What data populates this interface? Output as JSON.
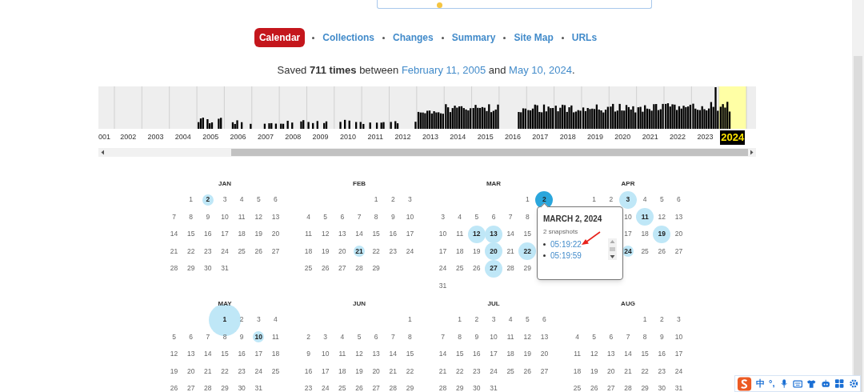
{
  "nav": [
    {
      "label": "Calendar",
      "selected": true
    },
    {
      "label": "Collections",
      "selected": false
    },
    {
      "label": "Changes",
      "selected": false
    },
    {
      "label": "Summary",
      "selected": false
    },
    {
      "label": "Site Map",
      "selected": false
    },
    {
      "label": "URLs",
      "selected": false
    }
  ],
  "summary": {
    "lead": "Saved **711 times** between",
    "start": "February 11, 2005",
    "middle": "and",
    "end": "May 10, 2024",
    "tail": "."
  },
  "years": [
    {
      "label": "001",
      "selected": false
    },
    {
      "label": "2002",
      "selected": false
    },
    {
      "label": "2003",
      "selected": false
    },
    {
      "label": "2004",
      "selected": false
    },
    {
      "label": "2005",
      "selected": false
    },
    {
      "label": "2006",
      "selected": false
    },
    {
      "label": "2007",
      "selected": false
    },
    {
      "label": "2008",
      "selected": false
    },
    {
      "label": "2009",
      "selected": false
    },
    {
      "label": "2010",
      "selected": false
    },
    {
      "label": "2011",
      "selected": false
    },
    {
      "label": "2012",
      "selected": false
    },
    {
      "label": "2013",
      "selected": false
    },
    {
      "label": "2014",
      "selected": false
    },
    {
      "label": "2015",
      "selected": false
    },
    {
      "label": "2016",
      "selected": false
    },
    {
      "label": "2017",
      "selected": false
    },
    {
      "label": "2018",
      "selected": false
    },
    {
      "label": "2019",
      "selected": false
    },
    {
      "label": "2020",
      "selected": false
    },
    {
      "label": "2021",
      "selected": false
    },
    {
      "label": "2022",
      "selected": false
    },
    {
      "label": "2023",
      "selected": false
    },
    {
      "label": "2024",
      "selected": true
    }
  ],
  "calendar": {
    "months": [
      {
        "name": "JAN",
        "weeks": [
          {
            "kind": "padded",
            "days": [
              "1",
              {
                "label": "2",
                "kind": "small",
                "selected": false
              },
              "3",
              "4",
              "5",
              "6"
            ]
          },
          {
            "days": [
              "7",
              "8",
              "9",
              "10",
              "11",
              "12",
              "13"
            ]
          },
          {
            "days": [
              "14",
              "15",
              "16",
              "17",
              "18",
              "19",
              "20"
            ]
          },
          {
            "days": [
              "21",
              "22",
              "23",
              "24",
              "25",
              "26",
              "27"
            ]
          },
          {
            "days": [
              "28",
              "29",
              "30",
              "31"
            ]
          }
        ]
      },
      {
        "name": "FEB",
        "weeks": [
          {
            "kind": "padded",
            "days": [
              "1",
              "2",
              "3"
            ]
          },
          {
            "days": [
              "4",
              "5",
              "6",
              "7",
              "8",
              "9",
              "10"
            ]
          },
          {
            "days": [
              "11",
              "12",
              "13",
              "14",
              "15",
              "16",
              "17"
            ]
          },
          {
            "days": [
              "18",
              "19",
              "20",
              {
                "label": "21",
                "kind": "small",
                "selected": false
              },
              "22",
              "23",
              "24"
            ]
          },
          {
            "days": [
              "25",
              "26",
              "27",
              "28",
              "29"
            ]
          }
        ]
      },
      {
        "name": "MAR",
        "weeks": [
          {
            "kind": "padded",
            "days": [
              "1",
              {
                "label": "2",
                "kind": "medium",
                "selected": true
              }
            ]
          },
          {
            "days": [
              "3",
              "4",
              "5",
              "6",
              "7",
              "8"
            ]
          },
          {
            "days": [
              "10",
              "11",
              {
                "label": "12",
                "kind": "medium",
                "selected": false
              },
              {
                "label": "13",
                "kind": "medium",
                "selected": false
              },
              "14",
              "15"
            ]
          },
          {
            "days": [
              "17",
              "18",
              "19",
              {
                "label": "20",
                "kind": "medium",
                "selected": false
              },
              "21",
              {
                "label": "22",
                "kind": "medium",
                "selected": false
              }
            ]
          },
          {
            "days": [
              "24",
              "25",
              "26",
              {
                "label": "27",
                "kind": "medium",
                "selected": false
              },
              "28",
              "29"
            ]
          },
          {
            "days": [
              "31"
            ]
          }
        ]
      },
      {
        "name": "APR",
        "weeks": [
          {
            "kind": "padded",
            "days": [
              "1",
              "2",
              {
                "label": "3",
                "kind": "medium",
                "selected": false
              },
              "4",
              "5",
              "6"
            ]
          },
          {
            "kind": "padded",
            "days": [
              "10",
              {
                "label": "11",
                "kind": "medium",
                "selected": false
              },
              "12",
              "13"
            ]
          },
          {
            "kind": "padded",
            "days": [
              "17",
              "18",
              {
                "label": "19",
                "kind": "medium",
                "selected": false
              },
              "20"
            ]
          },
          {
            "kind": "padded",
            "days": [
              {
                "label": "24",
                "kind": "small",
                "selected": false
              },
              "25",
              "26",
              "27"
            ]
          }
        ]
      },
      {
        "name": "MAY",
        "weeks": [
          {
            "kind": "padded",
            "days": [
              {
                "label": "1",
                "kind": "large",
                "selected": false
              },
              "2",
              "3",
              "4"
            ]
          },
          {
            "days": [
              "5",
              "6",
              "7",
              "8",
              "9",
              {
                "label": "10",
                "kind": "small",
                "selected": false
              },
              "11"
            ]
          },
          {
            "days": [
              "12",
              "13",
              "14",
              "15",
              "16",
              "17",
              "18"
            ]
          },
          {
            "days": [
              "19",
              "20",
              "21",
              "22",
              "23",
              "24",
              "25"
            ]
          },
          {
            "days": [
              "26",
              "27",
              "28",
              "29",
              "30",
              "31"
            ]
          }
        ]
      },
      {
        "name": "JUN",
        "weeks": [
          {
            "kind": "padded",
            "days": [
              "1"
            ]
          },
          {
            "days": [
              "2",
              "3",
              "4",
              "5",
              "6",
              "7",
              "8"
            ]
          },
          {
            "days": [
              "9",
              "10",
              "11",
              "12",
              "13",
              "14",
              "15"
            ]
          },
          {
            "days": [
              "16",
              "17",
              "18",
              "19",
              "20",
              "21",
              "22"
            ]
          },
          {
            "days": [
              "23",
              "24",
              "25",
              "26",
              "27",
              "28",
              "29"
            ]
          }
        ]
      },
      {
        "name": "JUL",
        "weeks": [
          {
            "kind": "padded",
            "days": [
              "1",
              "2",
              "3",
              "4",
              "5",
              "6"
            ]
          },
          {
            "days": [
              "7",
              "8",
              "9",
              "10",
              "11",
              "12",
              "13"
            ]
          },
          {
            "days": [
              "14",
              "15",
              "16",
              "17",
              "18",
              "19",
              "20"
            ]
          },
          {
            "days": [
              "21",
              "22",
              "23",
              "24",
              "25",
              "26",
              "27"
            ]
          },
          {
            "days": [
              "28",
              "29",
              "30",
              "31"
            ]
          }
        ]
      },
      {
        "name": "AUG",
        "weeks": [
          {
            "kind": "padded",
            "days": [
              "1",
              "2",
              "3"
            ]
          },
          {
            "days": [
              "4",
              "5",
              "6",
              "7",
              "8",
              "9",
              "10"
            ]
          },
          {
            "days": [
              "11",
              "12",
              "13",
              "14",
              "15",
              "16",
              "17"
            ]
          },
          {
            "days": [
              "18",
              "19",
              "20",
              "21",
              "22",
              "23",
              "24"
            ]
          },
          {
            "days": [
              "25",
              "26",
              "27",
              "28",
              "29",
              "30",
              "31"
            ]
          }
        ]
      }
    ]
  },
  "popup": {
    "title": "MARCH 2, 2024",
    "count": "2 snapshots",
    "times": [
      "05:19:22",
      "05:19:59"
    ]
  },
  "ime_toolbar": {
    "items": [
      "中",
      "°,"
    ]
  }
}
